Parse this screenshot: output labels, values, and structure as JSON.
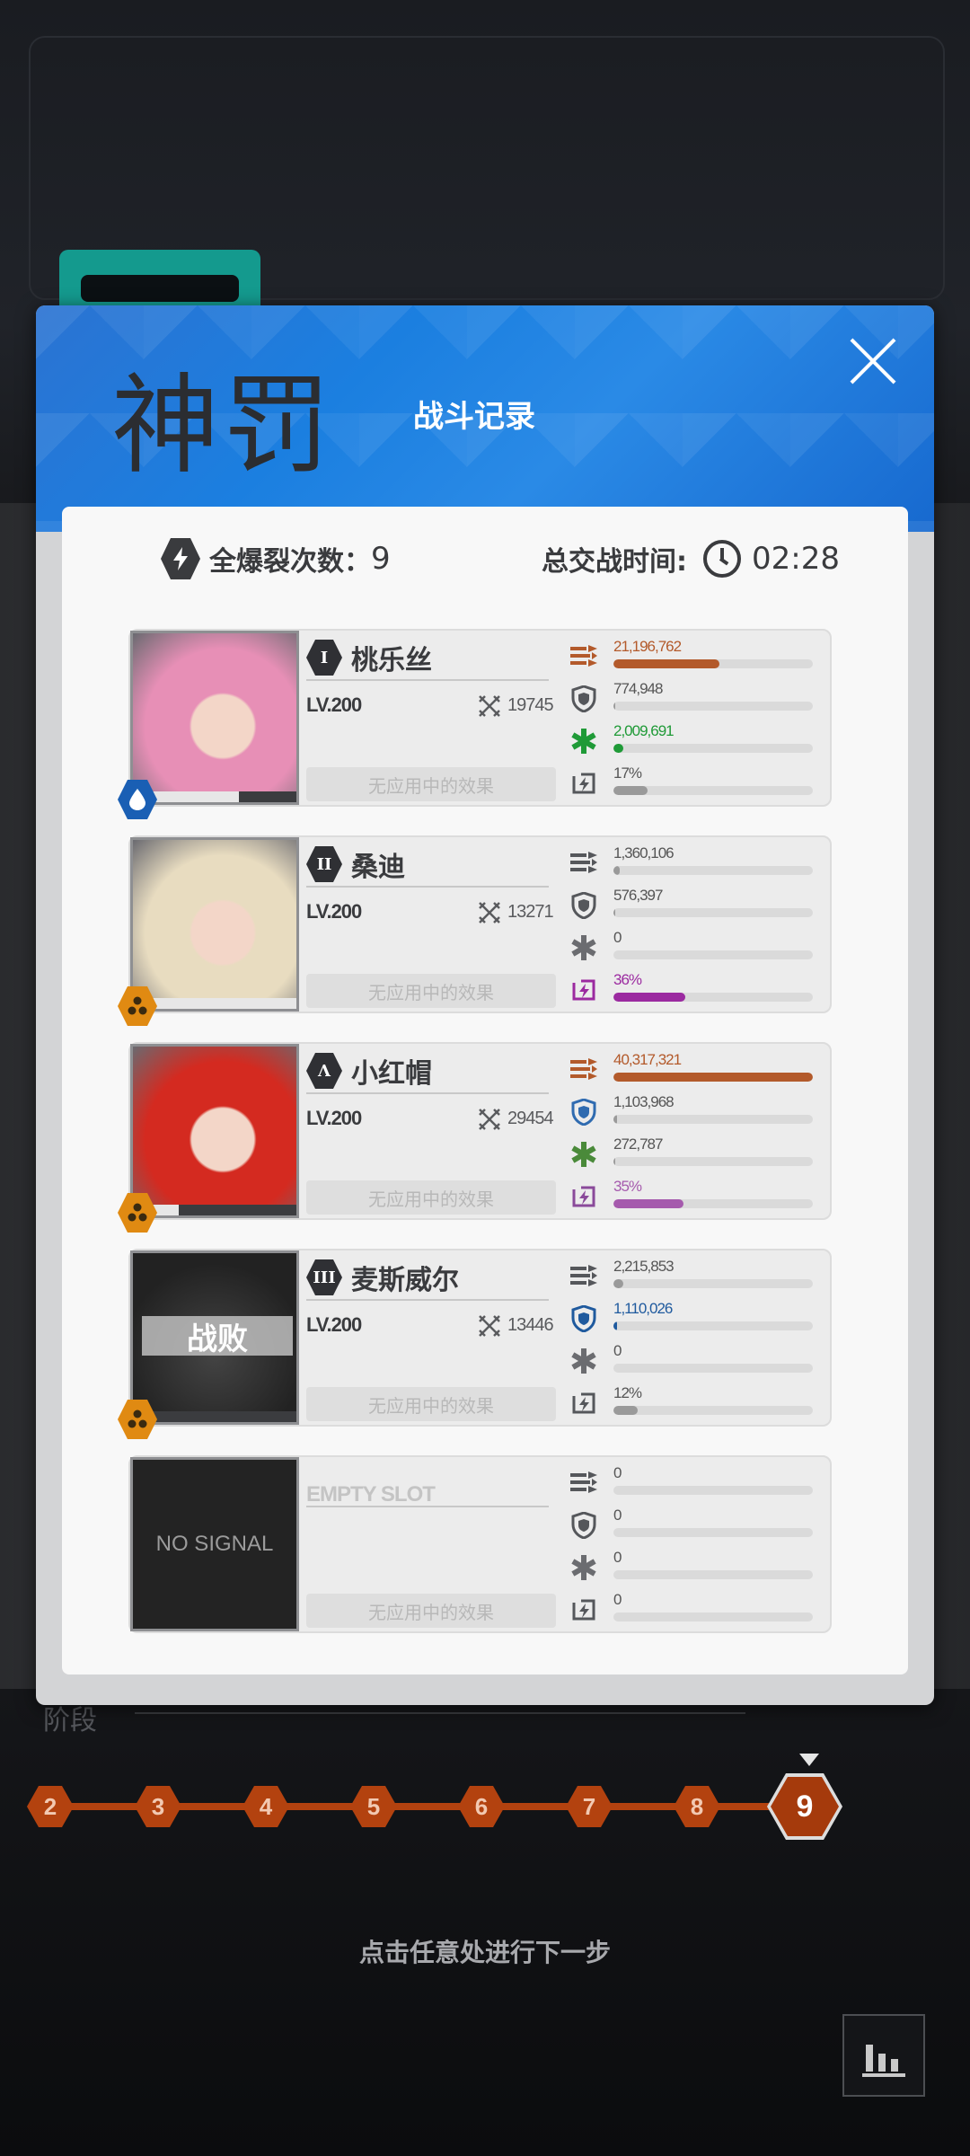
{
  "boss_name": "神罚",
  "modal_title": "战斗记录",
  "summary": {
    "burst_label": "全爆裂次数：",
    "burst_count": "9",
    "time_label": "总交战时间:",
    "time_value": "02:28"
  },
  "effects_label": "无应用中的效果",
  "characters": [
    {
      "burst": "I",
      "name": "桃乐丝",
      "level": "LV.200",
      "power": "19745",
      "element": "water",
      "hp_fraction": 0.65,
      "stats": {
        "damage": {
          "text": "21,196,762",
          "fraction": 0.53,
          "color": "#b35a2b"
        },
        "shield": {
          "text": "774,948",
          "fraction": 0.01,
          "color": "#9a9a9a"
        },
        "heal": {
          "text": "2,009,691",
          "fraction": 0.05,
          "color": "#1f9a37"
        },
        "burst": {
          "text": "17%",
          "fraction": 0.17,
          "color": "#9a9a9a"
        }
      },
      "hair": "#e78fb6"
    },
    {
      "burst": "II",
      "name": "桑迪",
      "level": "LV.200",
      "power": "13271",
      "element": "burst",
      "hp_fraction": 1.0,
      "stats": {
        "damage": {
          "text": "1,360,106",
          "fraction": 0.03,
          "color": "#9a9a9a"
        },
        "shield": {
          "text": "576,397",
          "fraction": 0.01,
          "color": "#9a9a9a"
        },
        "heal": {
          "text": "0",
          "fraction": 0,
          "color": "#9a9a9a"
        },
        "burst": {
          "text": "36%",
          "fraction": 0.36,
          "color": "#9b2aa0"
        }
      },
      "hair": "#e8dcc0"
    },
    {
      "burst": "Λ",
      "name": "小红帽",
      "level": "LV.200",
      "power": "29454",
      "element": "burst",
      "hp_fraction": 0.28,
      "stats": {
        "damage": {
          "text": "40,317,321",
          "fraction": 1.0,
          "color": "#b35a2b"
        },
        "shield": {
          "text": "1,103,968",
          "fraction": 0.02,
          "color": "#9a9a9a"
        },
        "heal": {
          "text": "272,787",
          "fraction": 0.01,
          "color": "#9a9a9a"
        },
        "burst": {
          "text": "35%",
          "fraction": 0.35,
          "color": "#a55aad"
        }
      },
      "hair": "#d42a20"
    },
    {
      "burst": "III",
      "name": "麦斯威尔",
      "level": "LV.200",
      "power": "13446",
      "element": "burst",
      "hp_fraction": 0,
      "defeated_label": "战败",
      "stats": {
        "damage": {
          "text": "2,215,853",
          "fraction": 0.05,
          "color": "#9a9a9a"
        },
        "shield": {
          "text": "1,110,026",
          "fraction": 0.02,
          "color": "#1f5a9e"
        },
        "heal": {
          "text": "0",
          "fraction": 0,
          "color": "#9a9a9a"
        },
        "burst": {
          "text": "12%",
          "fraction": 0.12,
          "color": "#9a9a9a"
        }
      },
      "hair": "#3a3a3a"
    },
    {
      "empty": true,
      "name": "EMPTY SLOT",
      "portrait_text": "NO SIGNAL",
      "stats": {
        "damage": {
          "text": "0",
          "fraction": 0,
          "color": "#9a9a9a"
        },
        "shield": {
          "text": "0",
          "fraction": 0,
          "color": "#9a9a9a"
        },
        "heal": {
          "text": "0",
          "fraction": 0,
          "color": "#9a9a9a"
        },
        "burst": {
          "text": "0",
          "fraction": 0,
          "color": "#9a9a9a"
        }
      }
    }
  ],
  "stage": {
    "label": "阶段",
    "nodes": [
      "2",
      "3",
      "4",
      "5",
      "6",
      "7",
      "8",
      "9"
    ],
    "active": "9"
  },
  "continue_hint": "点击任意处进行下一步",
  "colors": {
    "accent_blue": "#1b7fe0",
    "stage_orange": "#b3420f"
  }
}
